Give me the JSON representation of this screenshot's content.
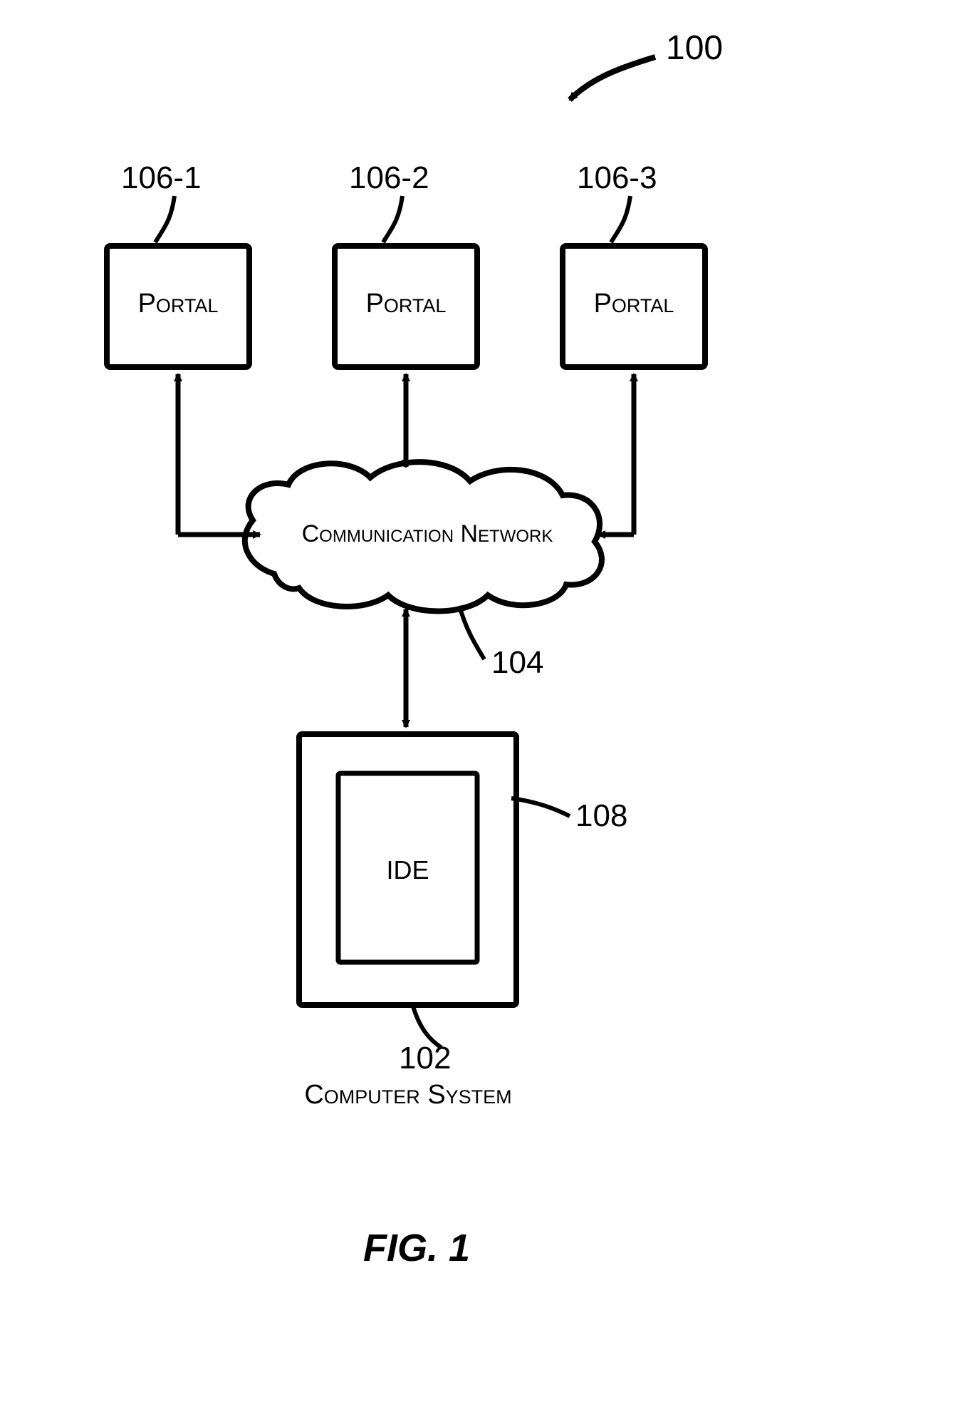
{
  "diagram": {
    "system_ref": "100",
    "portals": [
      {
        "ref": "106-1",
        "label": "Portal"
      },
      {
        "ref": "106-2",
        "label": "Portal"
      },
      {
        "ref": "106-3",
        "label": "Portal"
      }
    ],
    "network": {
      "ref": "104",
      "label": "Communication Network"
    },
    "computer": {
      "ref": "102",
      "label": "Computer System",
      "ide": {
        "ref": "108",
        "label": "IDE"
      }
    },
    "figure_caption": "FIG. 1"
  }
}
